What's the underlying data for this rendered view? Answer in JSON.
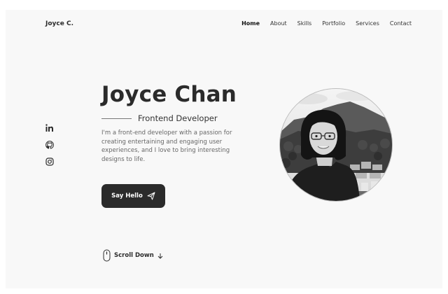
{
  "header": {
    "logo": "Joyce C.",
    "nav": [
      {
        "label": "Home",
        "active": true
      },
      {
        "label": "About"
      },
      {
        "label": "Skills"
      },
      {
        "label": "Portfolio"
      },
      {
        "label": "Services"
      },
      {
        "label": "Contact"
      }
    ]
  },
  "hero": {
    "name": "Joyce Chan",
    "subtitle": "Frontend Developer",
    "description": "I'm a front-end developer with a passion for creating entertaining and engaging user experiences, and I love to bring interesting designs to life.",
    "cta_label": "Say Hello",
    "cta_icon": "send-icon"
  },
  "socials": [
    {
      "icon": "linkedin-icon"
    },
    {
      "icon": "github-icon"
    },
    {
      "icon": "instagram-icon"
    }
  ],
  "scroll": {
    "label": "Scroll Down",
    "icon": "mouse-icon",
    "arrow_icon": "arrow-down-icon"
  },
  "colors": {
    "text_dark": "#2b2b2b",
    "background": "#f8f8f8",
    "button": "#2b2b2b"
  }
}
